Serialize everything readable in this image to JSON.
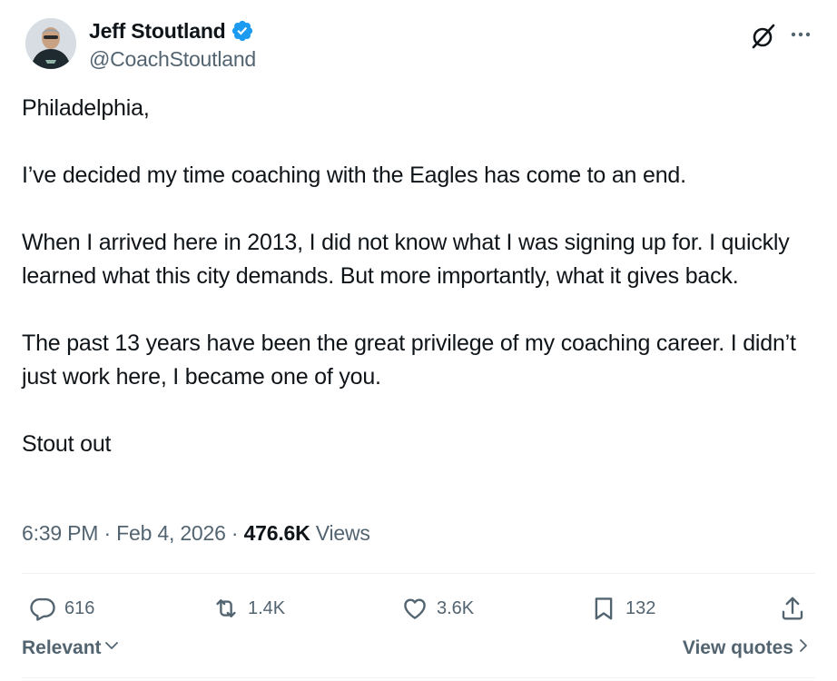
{
  "author": {
    "name": "Jeff Stoutland",
    "handle": "@CoachStoutland",
    "verified": true
  },
  "tweet": {
    "paragraphs": [
      "Philadelphia,",
      "I’ve decided my time coaching with the Eagles has come to an end.",
      "When I arrived here in 2013, I did not know what I was signing up for. I quickly learned what this city demands. But more importantly, what it gives back.",
      "The past 13 years have been the great privilege of my coaching career. I didn’t just work here, I became one of you.",
      "Stout out"
    ],
    "time": "6:39 PM",
    "separator": "·",
    "date": "Feb 4, 2026",
    "views_count": "476.6K",
    "views_label": "Views"
  },
  "actions": {
    "replies": "616",
    "reposts": "1.4K",
    "likes": "3.6K",
    "bookmarks": "132"
  },
  "footer": {
    "sort_label": "Relevant",
    "quotes_label": "View quotes"
  },
  "icons": {
    "verified": "verified-badge-icon",
    "grok": "grok-icon",
    "more": "more-dots-icon",
    "reply": "reply-bubble-icon",
    "repost": "repost-icon",
    "like": "heart-icon",
    "bookmark": "bookmark-icon",
    "share": "share-upload-icon"
  },
  "colors": {
    "verified_blue": "#1d9bf0",
    "text_primary": "#0f1419",
    "text_secondary": "#536471",
    "divider": "#eff3f4"
  }
}
